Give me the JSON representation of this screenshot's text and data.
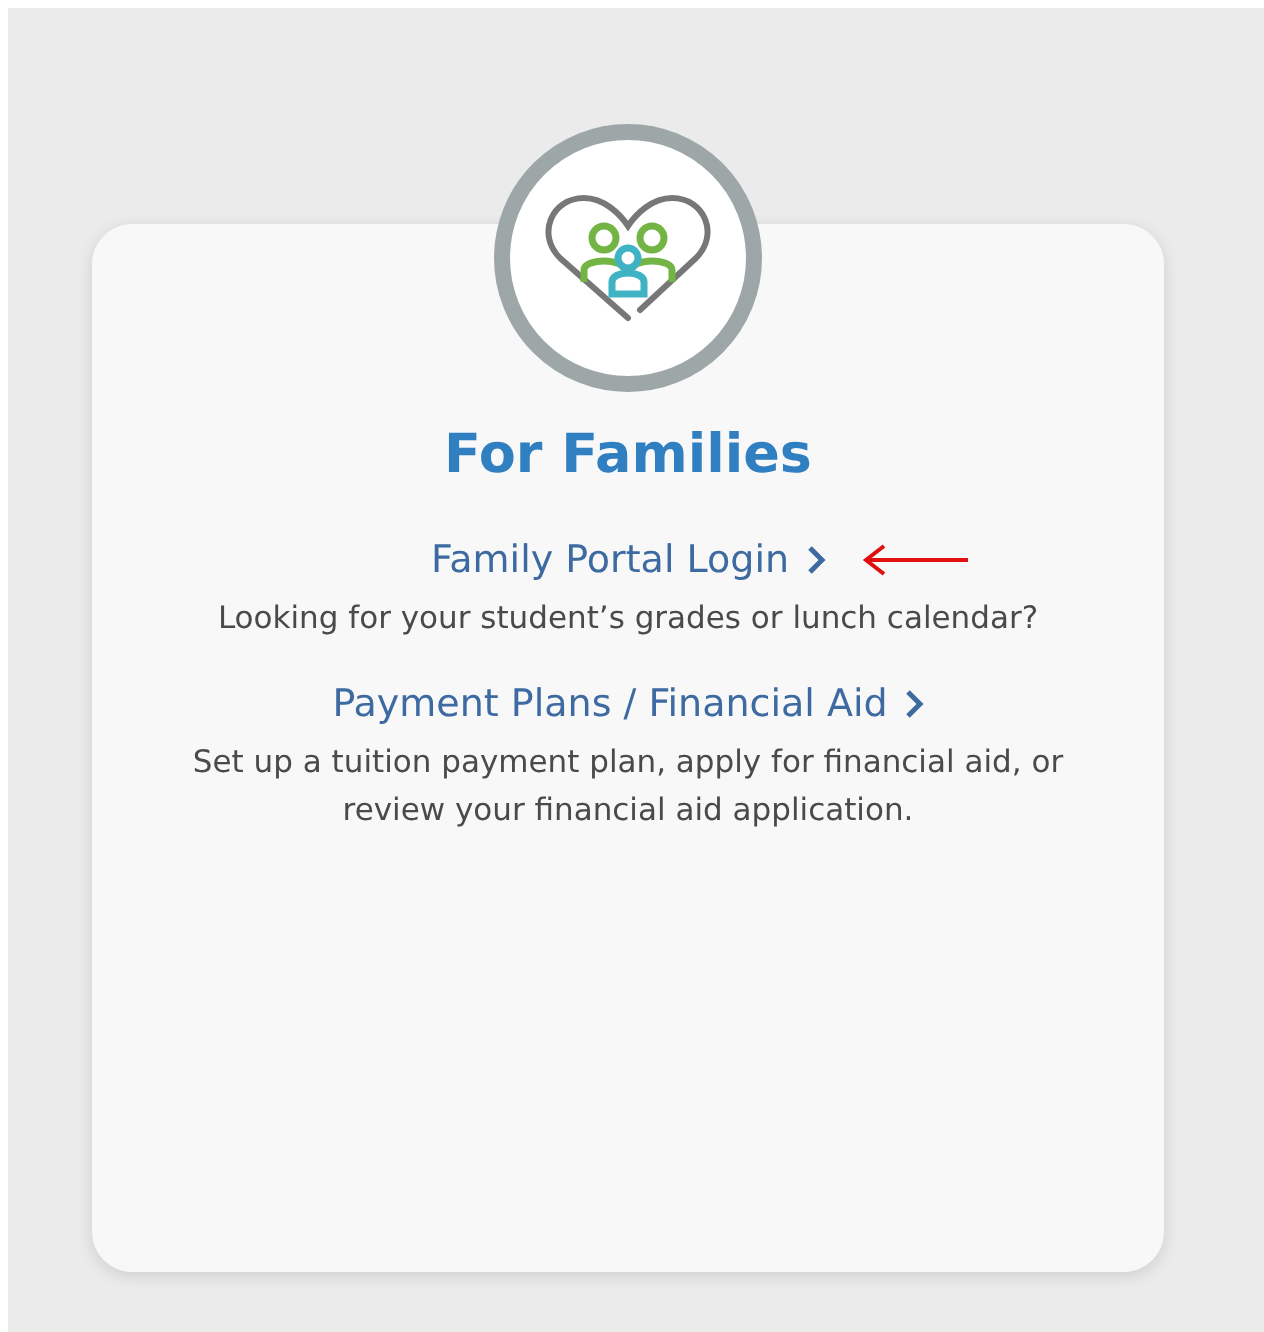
{
  "card": {
    "title": "For Families",
    "links": [
      {
        "label": "Family Portal Login",
        "description": "Looking for your student’s grades or lunch calendar?",
        "marked": true
      },
      {
        "label": "Payment Plans / Financial Aid",
        "description": "Set up a tuition payment plan, apply for financial aid, or review your financial aid application.",
        "marked": false
      }
    ]
  }
}
